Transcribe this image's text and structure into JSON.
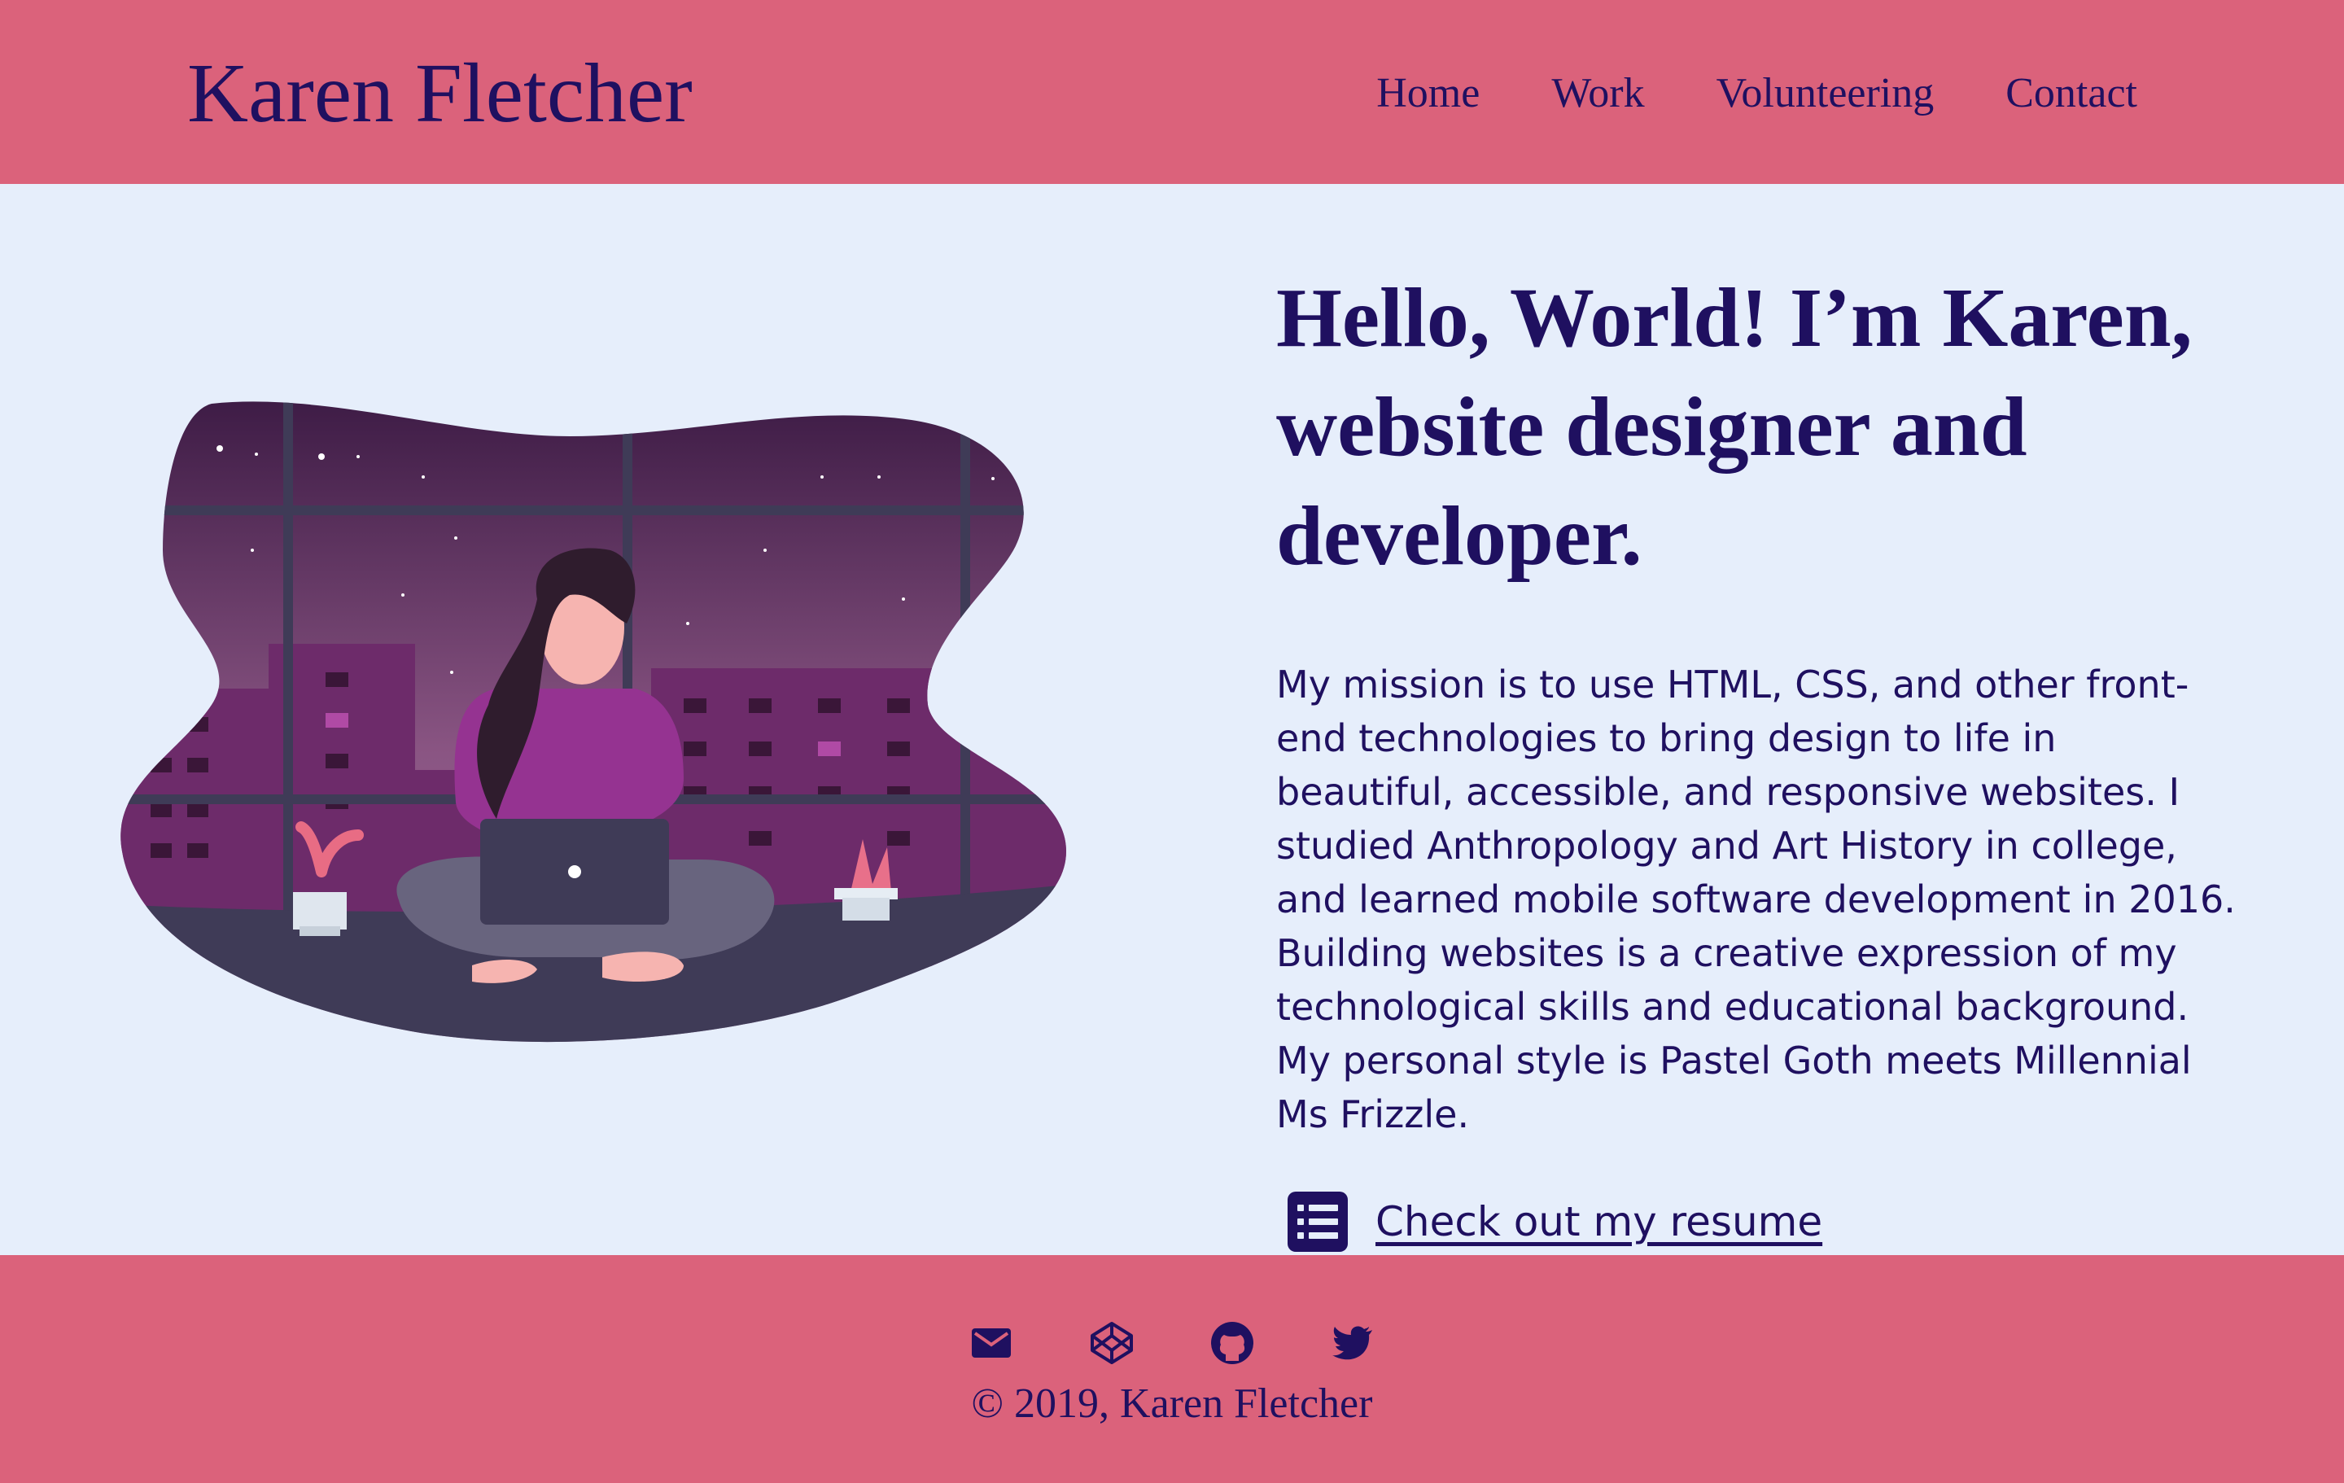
{
  "site": {
    "name": "Karen Fletcher"
  },
  "nav": {
    "items": [
      "Home",
      "Work",
      "Volunteering",
      "Contact"
    ]
  },
  "hero": {
    "headline": "Hello, World! I’m Karen, website designer and developer.",
    "mission": "My mission is to use HTML, CSS, and other front-end technologies to bring design to life in beautiful, accessible, and responsive websites. I studied Anthropology and Art History in college, and learned mobile software development in 2016. Building websites is a creative expression of my technological skills and educational background. My personal style is Pastel Goth meets Millennial Ms Frizzle.",
    "resume_link": "Check out my resume",
    "resume_icon": "list-icon",
    "illustration": "woman-with-laptop-illustration"
  },
  "footer": {
    "icons": [
      "email-icon",
      "codepen-icon",
      "github-icon",
      "twitter-icon"
    ],
    "copyright": "© 2019, Karen Fletcher"
  },
  "colors": {
    "header_bg": "#db627b",
    "page_bg": "#e6eefb",
    "text": "#1f1060"
  }
}
